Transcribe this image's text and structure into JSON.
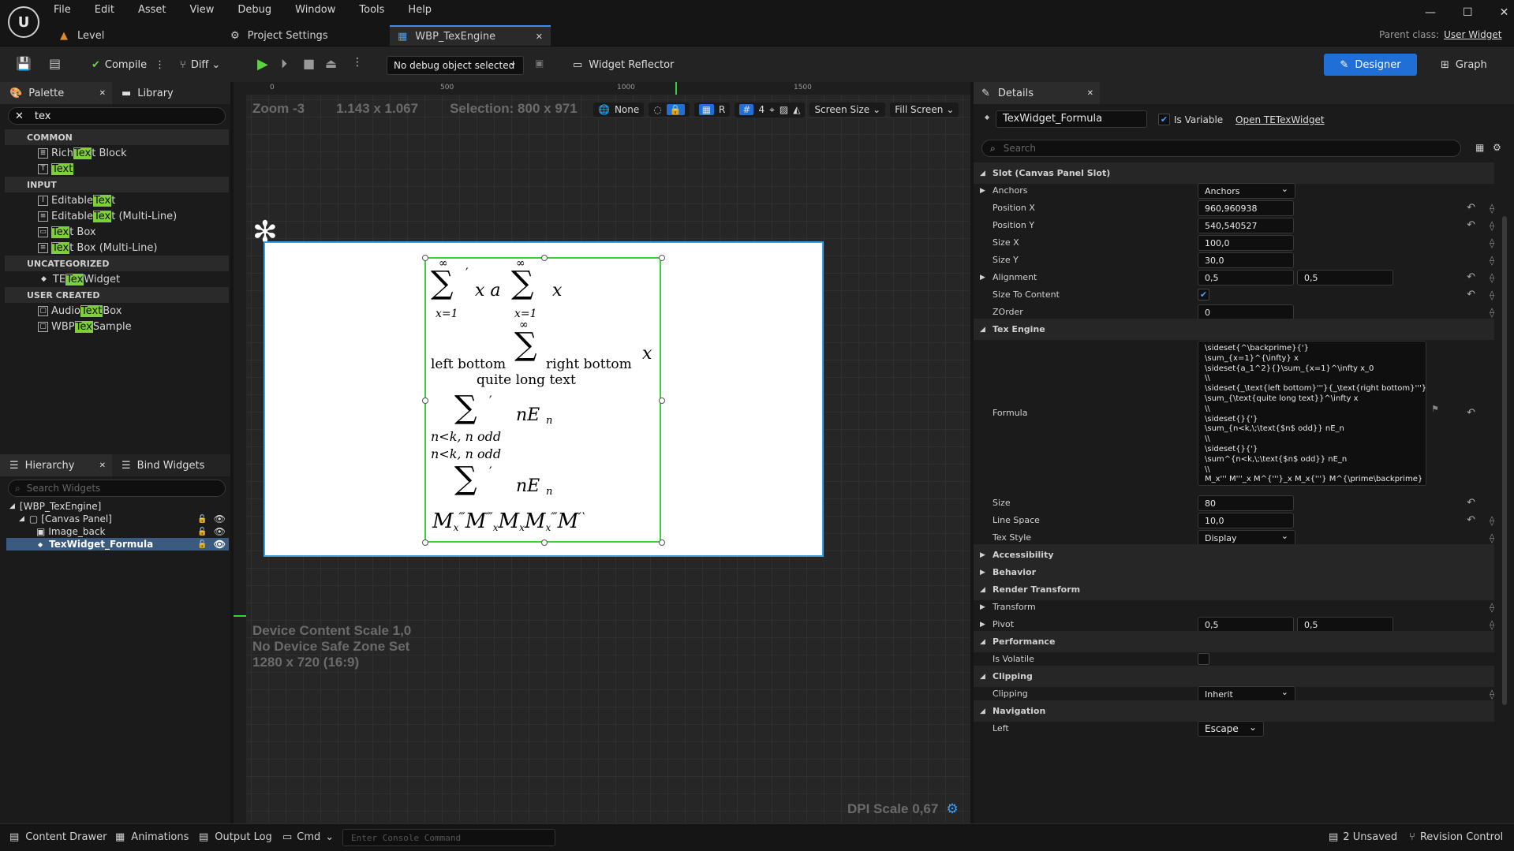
{
  "menu": [
    "File",
    "Edit",
    "Asset",
    "View",
    "Debug",
    "Window",
    "Tools",
    "Help"
  ],
  "tabs": {
    "level": "Level",
    "project": "Project Settings",
    "active": "WBP_TexEngine"
  },
  "parent_class": {
    "label": "Parent class:",
    "value": "User Widget"
  },
  "toolbar": {
    "compile": "Compile",
    "diff": "Diff",
    "debug_object": "No debug object selected",
    "reflector": "Widget Reflector",
    "designer": "Designer",
    "graph": "Graph"
  },
  "palette": {
    "tab": "Palette",
    "library": "Library",
    "search": "tex",
    "cat_common": "COMMON",
    "cat_input": "INPUT",
    "cat_uncat": "UNCATEGORIZED",
    "cat_user": "USER CREATED",
    "items": [
      {
        "pre": "Rich ",
        "hl": "Tex",
        "post": "t Block"
      },
      {
        "pre": "",
        "hl": "Text",
        "post": ""
      },
      {
        "pre": "Editable ",
        "hl": "Tex",
        "post": "t"
      },
      {
        "pre": "Editable ",
        "hl": "Tex",
        "post": "t (Multi-Line)"
      },
      {
        "pre": "",
        "hl": "Tex",
        "post": "t Box"
      },
      {
        "pre": "",
        "hl": "Tex",
        "post": "t Box (Multi-Line)"
      },
      {
        "pre": "TE",
        "hl": "Tex",
        "post": "Widget"
      },
      {
        "pre": "Audio ",
        "hl": "Text",
        "post": " Box"
      },
      {
        "pre": "WBP ",
        "hl": "Tex",
        "post": " Sample"
      }
    ]
  },
  "hierarchy": {
    "tab": "Hierarchy",
    "bind": "Bind Widgets",
    "search_placeholder": "Search Widgets",
    "root": "[WBP_TexEngine]",
    "canvas": "[Canvas Panel]",
    "image": "Image_back",
    "formula": "TexWidget_Formula"
  },
  "viewport": {
    "zoom": "Zoom -3",
    "size": "1.143 x 1.067",
    "selection": "Selection: 800 x 971",
    "none": "None",
    "r": "R",
    "grid": "4",
    "screen_size": "Screen Size",
    "fill": "Fill Screen",
    "ruler": [
      "0",
      "500",
      "1000",
      "1500"
    ],
    "device_scale": "Device Content Scale 1,0",
    "safe_zone": "No Device Safe Zone Set",
    "resolution": "1280 x 720 (16:9)",
    "dpi": "DPI Scale 0,67"
  },
  "formula_render": {
    "l1a": "x a",
    "l1b": "x",
    "l1sup": "′",
    "l1sub": "x=1",
    "inf": "∞",
    "l2a": "left bottom",
    "l2b": "right bottom",
    "l2c": "x",
    "l2d": "quite long text",
    "l3sub": "n<k, n odd",
    "l3": "nE",
    "n": "n",
    "l4": "M",
    "mx": "x"
  },
  "details": {
    "tab": "Details",
    "widget_name": "TexWidget_Formula",
    "is_variable": "Is Variable",
    "open": "Open TETexWidget",
    "search": "Search",
    "slot": "Slot (Canvas Panel Slot)",
    "anchors": "Anchors",
    "anchors_val": "Anchors",
    "pos_x": "Position X",
    "pos_x_val": "960,960938",
    "pos_y": "Position Y",
    "pos_y_val": "540,540527",
    "size_x": "Size X",
    "size_x_val": "100,0",
    "size_y": "Size Y",
    "size_y_val": "30,0",
    "alignment": "Alignment",
    "align_a": "0,5",
    "align_b": "0,5",
    "size_to_content": "Size To Content",
    "zorder": "ZOrder",
    "zorder_val": "0",
    "tex_engine": "Tex Engine",
    "formula": "Formula",
    "formula_lines": [
      "\\sideset{^\\backprime}{'}",
      "\\sum_{x=1}^{\\infty} x",
      "\\sideset{a_1^2}{}\\sum_{x=1}^\\infty x_0",
      "\\\\",
      "\\sideset{_\\text{left bottom}'''}{_\\text{right bottom}'''}",
      "\\sum_{\\text{quite long text}}^\\infty x",
      "\\\\",
      "\\sideset{}{'}",
      "\\sum_{n<k,\\;\\text{$n$ odd}} nE_n",
      "\\\\",
      "\\sideset{}{'}",
      "\\sum^{n<k,\\;\\text{$n$ odd}} nE_n",
      "\\\\",
      "M_x''' M'''_x M^{'''}_x M_x{'''} M^{\\prime\\backprime}"
    ],
    "size": "Size",
    "size_val": "80",
    "line_space": "Line Space",
    "line_space_val": "10,0",
    "tex_style": "Tex Style",
    "tex_style_val": "Display",
    "accessibility": "Accessibility",
    "behavior": "Behavior",
    "render_transform": "Render Transform",
    "transform": "Transform",
    "pivot": "Pivot",
    "pivot_a": "0,5",
    "pivot_b": "0,5",
    "performance": "Performance",
    "is_volatile": "Is Volatile",
    "clipping_sec": "Clipping",
    "clipping": "Clipping",
    "clipping_val": "Inherit",
    "navigation": "Navigation",
    "left": "Left",
    "left_val": "Escape"
  },
  "status": {
    "drawer": "Content Drawer",
    "anim": "Animations",
    "output": "Output Log",
    "cmd": "Cmd",
    "console_placeholder": "Enter Console Command",
    "unsaved": "2 Unsaved",
    "revision": "Revision Control"
  }
}
